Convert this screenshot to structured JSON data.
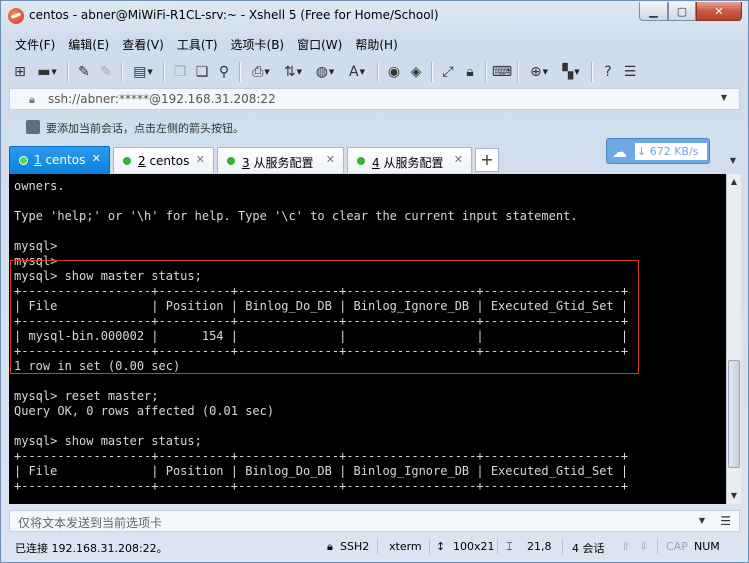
{
  "window": {
    "title": "centos - abner@MiWiFi-R1CL-srv:~ - Xshell 5 (Free for Home/School)",
    "min_label": "▁",
    "max_label": "▢",
    "close_label": "✕"
  },
  "menu": [
    "文件(F)",
    "编辑(E)",
    "查看(V)",
    "工具(T)",
    "选项卡(B)",
    "窗口(W)",
    "帮助(H)"
  ],
  "address": {
    "text": "ssh://abner:*****@192.168.31.208:22"
  },
  "hint": {
    "text": "要添加当前会话，点击左侧的箭头按钮。"
  },
  "tabs": [
    {
      "num": "1",
      "label": " centos"
    },
    {
      "num": "2",
      "label": " centos"
    },
    {
      "num": "3",
      "label": " 从服务配置"
    },
    {
      "num": "4",
      "label": " 从服务配置"
    }
  ],
  "tab_add": "+",
  "speed": {
    "value": "↓ 672 KB/s"
  },
  "terminal": {
    "lines": [
      "owners.",
      "",
      "Type 'help;' or '\\h' for help. Type '\\c' to clear the current input statement.",
      "",
      "mysql>",
      "mysql>",
      "mysql> show master status;",
      "+------------------+----------+--------------+------------------+-------------------+",
      "| File             | Position | Binlog_Do_DB | Binlog_Ignore_DB | Executed_Gtid_Set |",
      "+------------------+----------+--------------+------------------+-------------------+",
      "| mysql-bin.000002 |      154 |              |                  |                   |",
      "+------------------+----------+--------------+------------------+-------------------+",
      "1 row in set (0.00 sec)",
      "",
      "mysql> reset master;",
      "Query OK, 0 rows affected (0.01 sec)",
      "",
      "mysql> show master status;",
      "+------------------+----------+--------------+------------------+-------------------+",
      "| File             | Position | Binlog_Do_DB | Binlog_Ignore_DB | Executed_Gtid_Set |",
      "+------------------+----------+--------------+------------------+-------------------+"
    ]
  },
  "compose": {
    "placeholder": "仅将文本发送到当前选项卡"
  },
  "status": {
    "connection": "已连接 192.168.31.208:22。",
    "protocol": "SSH2",
    "term": "xterm",
    "size": "100x21",
    "cursor": "21,8",
    "sessions": "4 会话",
    "caps": "CAP",
    "num": "NUM"
  }
}
